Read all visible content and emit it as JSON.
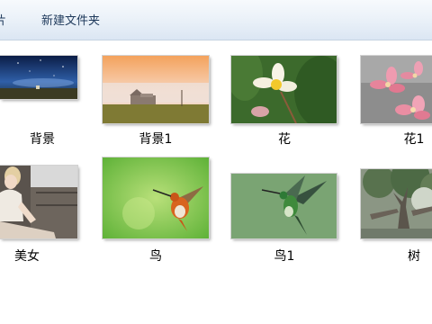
{
  "toolbar": {
    "partial_label": "片",
    "new_folder_label": "新建文件夹"
  },
  "items": [
    {
      "name": "背景",
      "icon": "night-sky-landscape-image"
    },
    {
      "name": "背景1",
      "icon": "sunrise-farmhouse-image"
    },
    {
      "name": "花",
      "icon": "plumeria-flower-image"
    },
    {
      "name": "花1",
      "icon": "pink-plumeria-image"
    },
    {
      "name": "美女",
      "icon": "woman-portrait-image"
    },
    {
      "name": "鸟",
      "icon": "rufous-hummingbird-image"
    },
    {
      "name": "鸟1",
      "icon": "green-hummingbird-image"
    },
    {
      "name": "树",
      "icon": "tree-canopy-image"
    }
  ]
}
